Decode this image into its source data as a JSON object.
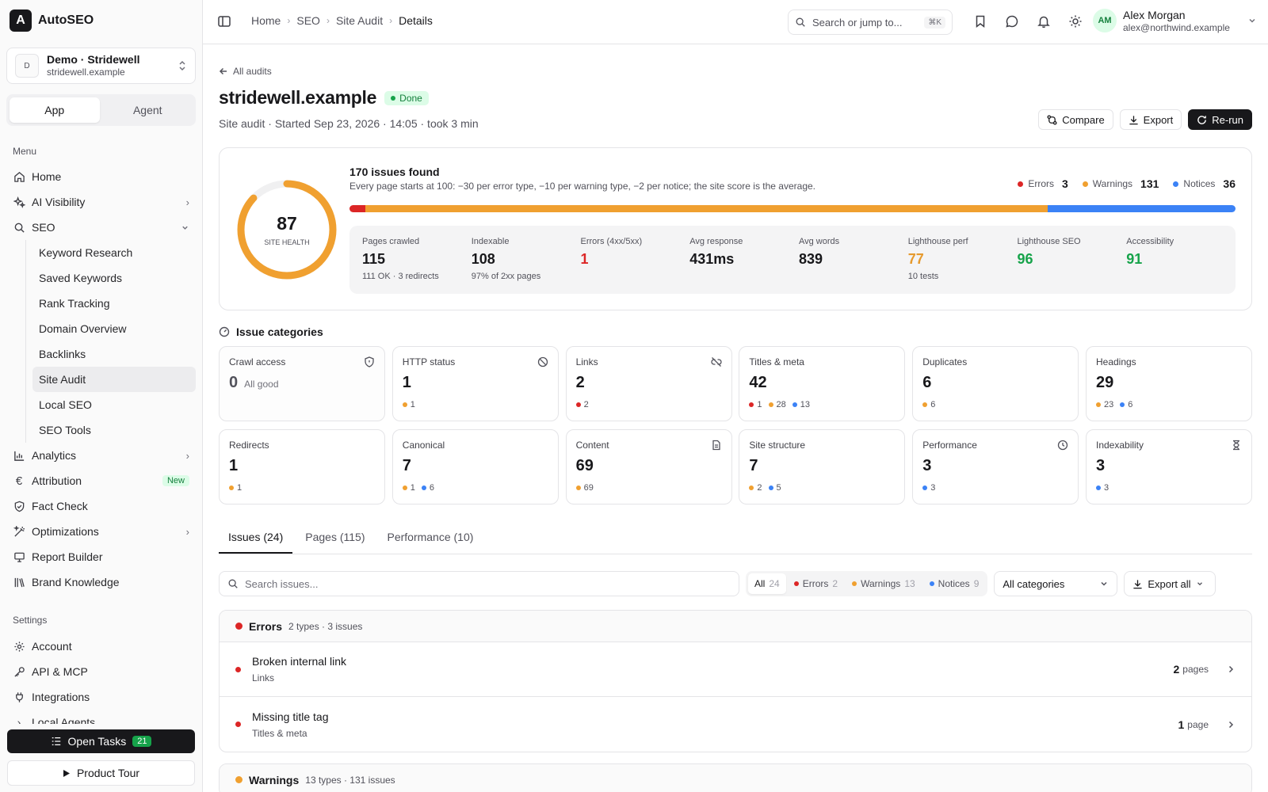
{
  "brand": {
    "name": "AutoSEO",
    "logo_letter": "A"
  },
  "workspace": {
    "avatar": "D",
    "name": "Demo · Stridewell",
    "domain": "stridewell.example"
  },
  "mode_toggle": [
    {
      "label": "App",
      "active": true
    },
    {
      "label": "Agent",
      "active": false
    }
  ],
  "sidebar": {
    "menu_label": "Menu",
    "items": [
      {
        "label": "Home",
        "icon": "home-icon"
      },
      {
        "label": "AI Visibility",
        "icon": "sparkle-icon",
        "chevron": "right"
      },
      {
        "label": "SEO",
        "icon": "search-icon",
        "chevron": "down"
      }
    ],
    "seo_sub": [
      "Keyword Research",
      "Saved Keywords",
      "Rank Tracking",
      "Domain Overview",
      "Backlinks",
      "Site Audit",
      "Local SEO",
      "SEO Tools"
    ],
    "active_sub": "Site Audit",
    "items2": [
      {
        "label": "Analytics",
        "icon": "bar-chart-icon",
        "chevron": "right"
      },
      {
        "label": "Attribution",
        "icon": "euro-icon",
        "badge": "New"
      },
      {
        "label": "Fact Check",
        "icon": "shield-check-icon"
      },
      {
        "label": "Optimizations",
        "icon": "wand-icon",
        "chevron": "right"
      },
      {
        "label": "Report Builder",
        "icon": "presentation-icon"
      },
      {
        "label": "Brand Knowledge",
        "icon": "library-icon"
      }
    ],
    "settings_label": "Settings",
    "settings": [
      {
        "label": "Account",
        "icon": "gear-icon"
      },
      {
        "label": "API & MCP",
        "icon": "key-icon"
      },
      {
        "label": "Integrations",
        "icon": "plug-icon"
      },
      {
        "label": "Local Agents",
        "icon": "chevron-right-icon"
      }
    ],
    "open_tasks": {
      "label": "Open Tasks",
      "count": "21"
    },
    "product_tour": "Product Tour"
  },
  "header": {
    "breadcrumb": [
      "Home",
      "SEO",
      "Site Audit",
      "Details"
    ],
    "search_placeholder": "Search or jump to...",
    "search_kbd": "⌘K",
    "user": {
      "initials": "AM",
      "name": "Alex Morgan",
      "email": "alex@northwind.example"
    }
  },
  "page": {
    "back_label": "All audits",
    "title": "stridewell.example",
    "status": "Done",
    "subtitle": "Site audit · Started Sep 23, 2026 · 14:05 · took 3 min",
    "actions": {
      "compare": "Compare",
      "export": "Export",
      "rerun": "Re-run"
    }
  },
  "summary": {
    "score": "87",
    "score_label": "SITE HEALTH",
    "score_fraction": 0.87,
    "issues_title": "170 issues found",
    "issues_desc": "Every page starts at 100: −30 per error type, −10 per warning type, −2 per notice; the site score is the average.",
    "legend": [
      {
        "label": "Errors",
        "value": "3",
        "color": "#dc2626"
      },
      {
        "label": "Warnings",
        "value": "131",
        "color": "#f0a030"
      },
      {
        "label": "Notices",
        "value": "36",
        "color": "#3b82f6"
      }
    ],
    "bar_counts": [
      3,
      131,
      36
    ],
    "stats": [
      {
        "label": "Pages crawled",
        "value": "115",
        "sub": "111 OK · 3 redirects",
        "color": "#18181b"
      },
      {
        "label": "Indexable",
        "value": "108",
        "sub": "97% of 2xx pages",
        "color": "#18181b"
      },
      {
        "label": "Errors (4xx/5xx)",
        "value": "1",
        "sub": "",
        "color": "#dc2626"
      },
      {
        "label": "Avg response",
        "value": "431ms",
        "sub": "",
        "color": "#18181b"
      },
      {
        "label": "Avg words",
        "value": "839",
        "sub": "",
        "color": "#18181b"
      },
      {
        "label": "Lighthouse perf",
        "value": "77",
        "sub": "10 tests",
        "color": "#e69a2e"
      },
      {
        "label": "Lighthouse SEO",
        "value": "96",
        "sub": "",
        "color": "#16a34a"
      },
      {
        "label": "Accessibility",
        "value": "91",
        "sub": "",
        "color": "#16a34a"
      }
    ]
  },
  "categories_title": "Issue categories",
  "categories": [
    {
      "name": "Crawl access",
      "count": "0",
      "note": "All good",
      "icon": "shield-icon",
      "dots": []
    },
    {
      "name": "HTTP status",
      "count": "1",
      "icon": "ban-icon",
      "dots": [
        {
          "c": "#f0a030",
          "n": "1"
        }
      ]
    },
    {
      "name": "Links",
      "count": "2",
      "icon": "unlink-icon",
      "dots": [
        {
          "c": "#dc2626",
          "n": "2"
        }
      ]
    },
    {
      "name": "Titles & meta",
      "count": "42",
      "icon": "",
      "dots": [
        {
          "c": "#dc2626",
          "n": "1"
        },
        {
          "c": "#f0a030",
          "n": "28"
        },
        {
          "c": "#3b82f6",
          "n": "13"
        }
      ]
    },
    {
      "name": "Duplicates",
      "count": "6",
      "icon": "",
      "dots": [
        {
          "c": "#f0a030",
          "n": "6"
        }
      ]
    },
    {
      "name": "Headings",
      "count": "29",
      "icon": "",
      "dots": [
        {
          "c": "#f0a030",
          "n": "23"
        },
        {
          "c": "#3b82f6",
          "n": "6"
        }
      ]
    },
    {
      "name": "Redirects",
      "count": "1",
      "icon": "",
      "dots": [
        {
          "c": "#f0a030",
          "n": "1"
        }
      ]
    },
    {
      "name": "Canonical",
      "count": "7",
      "icon": "",
      "dots": [
        {
          "c": "#f0a030",
          "n": "1"
        },
        {
          "c": "#3b82f6",
          "n": "6"
        }
      ]
    },
    {
      "name": "Content",
      "count": "69",
      "icon": "file-text-icon",
      "dots": [
        {
          "c": "#f0a030",
          "n": "69"
        }
      ]
    },
    {
      "name": "Site structure",
      "count": "7",
      "icon": "",
      "dots": [
        {
          "c": "#f0a030",
          "n": "2"
        },
        {
          "c": "#3b82f6",
          "n": "5"
        }
      ]
    },
    {
      "name": "Performance",
      "count": "3",
      "icon": "clock-icon",
      "dots": [
        {
          "c": "#3b82f6",
          "n": "3"
        }
      ]
    },
    {
      "name": "Indexability",
      "count": "3",
      "icon": "hourglass-icon",
      "dots": [
        {
          "c": "#3b82f6",
          "n": "3"
        }
      ]
    }
  ],
  "tabs": [
    {
      "label": "Issues (24)",
      "active": true
    },
    {
      "label": "Pages (115)",
      "active": false
    },
    {
      "label": "Performance (10)",
      "active": false
    }
  ],
  "filters": {
    "search_placeholder": "Search issues...",
    "segments": [
      {
        "label": "All",
        "n": "24",
        "color": "",
        "active": true
      },
      {
        "label": "Errors",
        "n": "2",
        "color": "#dc2626",
        "active": false
      },
      {
        "label": "Warnings",
        "n": "13",
        "color": "#f0a030",
        "active": false
      },
      {
        "label": "Notices",
        "n": "9",
        "color": "#3b82f6",
        "active": false
      }
    ],
    "category_select": "All categories",
    "export_all": "Export all"
  },
  "groups": {
    "errors": {
      "title": "Errors",
      "meta": "2 types · 3 issues",
      "color": "#dc2626",
      "rows": [
        {
          "name": "Broken internal link",
          "category": "Links",
          "count": "2",
          "unit": "pages"
        },
        {
          "name": "Missing title tag",
          "category": "Titles & meta",
          "count": "1",
          "unit": "page"
        }
      ]
    },
    "warnings": {
      "title": "Warnings",
      "meta": "13 types · 131 issues",
      "color": "#f0a030"
    }
  }
}
